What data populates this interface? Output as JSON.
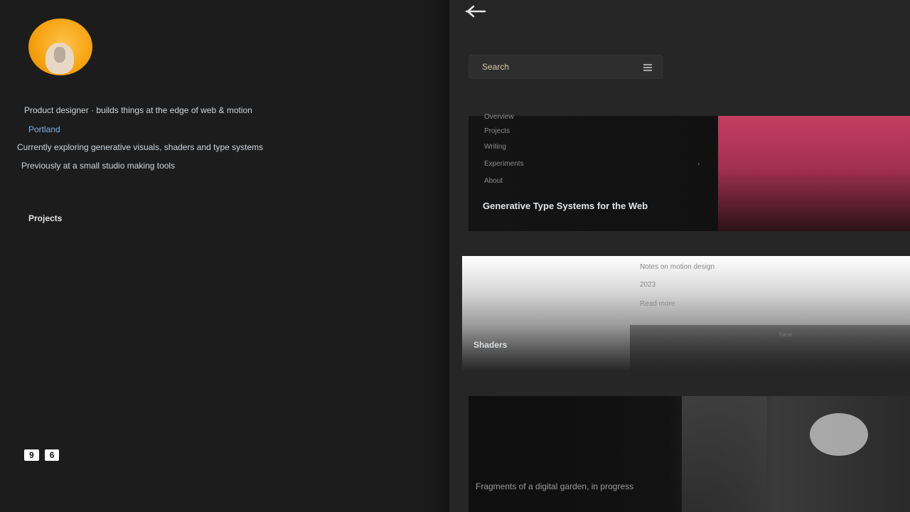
{
  "profile": {
    "bio_line_1": "Product designer · builds things at the edge of web & motion",
    "bio_line_2": "Portland",
    "bio_line_3": "Currently exploring generative visuals, shaders and type systems",
    "bio_line_4": "Previously at a small studio making tools",
    "section_label": "Projects",
    "stats": [
      "9",
      "6"
    ]
  },
  "toolbar": {
    "back_icon": "back-arrow-icon"
  },
  "search": {
    "placeholder": "Search",
    "icon": "search-icon"
  },
  "card1": {
    "menu": [
      "Overview",
      "Projects",
      "Writing",
      "Experiments",
      "About"
    ],
    "title": "Generative Type Systems for the Web",
    "accent_color": "#c63d61"
  },
  "card2": {
    "line_1": "Notes on motion design",
    "line_2": "2023",
    "line_3": "Read more",
    "strip_text": "New",
    "tag": "Shaders"
  },
  "card3": {
    "caption": "Fragments of a digital garden, in progress"
  }
}
